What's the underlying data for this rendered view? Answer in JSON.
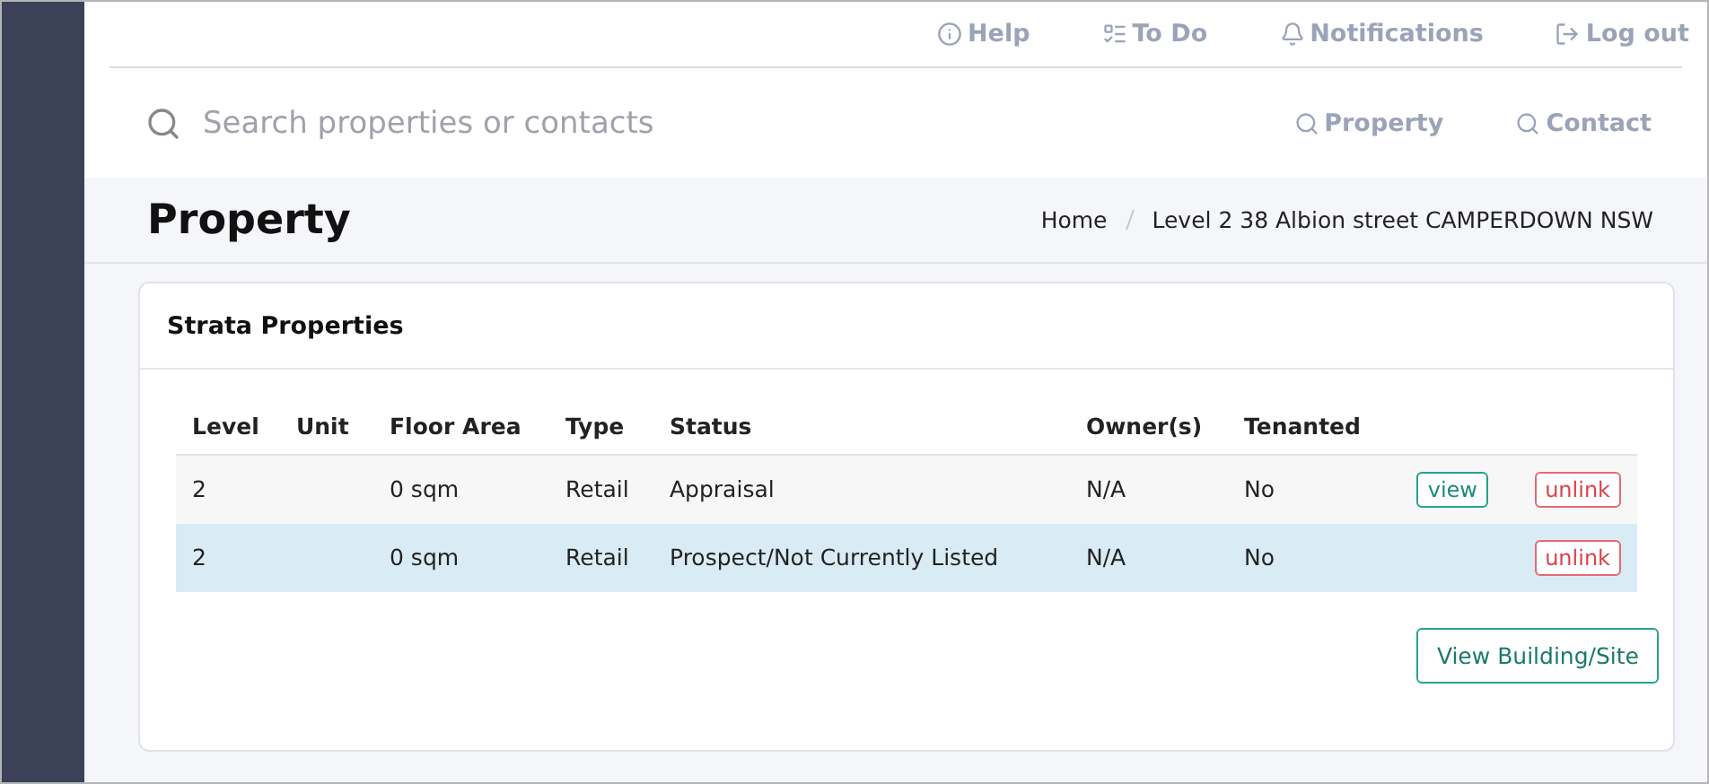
{
  "top_nav": [
    {
      "kind": "info",
      "label": "Help"
    },
    {
      "kind": "todo",
      "label": "To Do"
    },
    {
      "kind": "bell",
      "label": "Notifications"
    },
    {
      "kind": "logout",
      "label": "Log out"
    }
  ],
  "search": {
    "placeholder": "Search properties or contacts"
  },
  "search_scopes": [
    "Property",
    "Contact"
  ],
  "page_title": "Property",
  "breadcrumb": [
    "Home",
    "Level 2 38 Albion street CAMPERDOWN NSW"
  ],
  "card": {
    "title": "Strata Properties",
    "columns": [
      "Level",
      "Unit",
      "Floor Area",
      "Type",
      "Status",
      "Owner(s)",
      "Tenanted"
    ],
    "rows": [
      {
        "cells": [
          "2",
          "",
          "0 sqm",
          "Retail",
          "Appraisal",
          "N/A",
          "No"
        ],
        "selected": false,
        "actions": [
          "view",
          "unlink"
        ]
      },
      {
        "cells": [
          "2",
          "",
          "0 sqm",
          "Retail",
          "Prospect/Not Currently Listed",
          "N/A",
          "No"
        ],
        "selected": true,
        "actions": [
          "unlink"
        ]
      }
    ],
    "footer_button": "View Building/Site"
  }
}
